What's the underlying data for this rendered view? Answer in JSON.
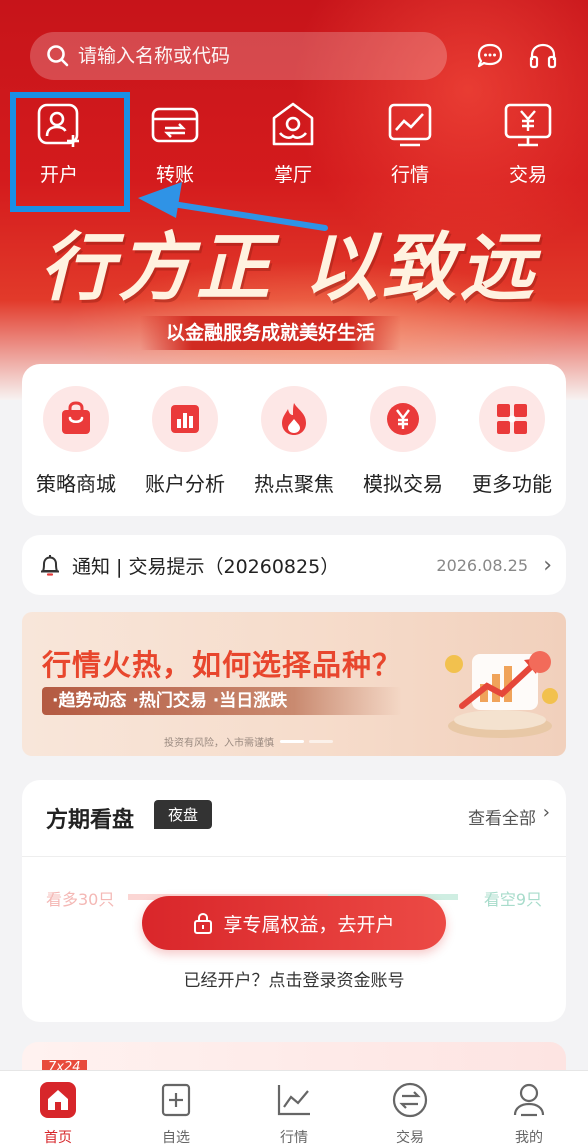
{
  "search": {
    "placeholder": "请输入名称或代码"
  },
  "top_icons": [
    "chat-icon",
    "headset-icon"
  ],
  "quick_nav": [
    {
      "label": "开户",
      "icon": "open-account-icon"
    },
    {
      "label": "转账",
      "icon": "transfer-icon"
    },
    {
      "label": "掌厅",
      "icon": "hall-icon"
    },
    {
      "label": "行情",
      "icon": "market-icon"
    },
    {
      "label": "交易",
      "icon": "trade-icon"
    }
  ],
  "hero": {
    "slogan": "行方正 以致远",
    "subtitle": "以金融服务成就美好生活"
  },
  "features": [
    {
      "label": "策略商城",
      "icon": "shopping-bag-icon"
    },
    {
      "label": "账户分析",
      "icon": "bar-chart-icon"
    },
    {
      "label": "热点聚焦",
      "icon": "flame-icon"
    },
    {
      "label": "模拟交易",
      "icon": "yen-coin-icon"
    },
    {
      "label": "更多功能",
      "icon": "grid-icon"
    }
  ],
  "notice": {
    "title": "通知 | 交易提示（20260825）",
    "date": "2026.08.25"
  },
  "banner": {
    "headline": "行情火热，如何选择品种？",
    "tags": "·趋势动态  ·热门交易  ·当日涨跌",
    "risk": "投资有风险，入市需谨慎"
  },
  "market": {
    "title": "方期看盘",
    "badge": "夜盘",
    "view_all": "查看全部",
    "bull": "看多30只",
    "bear": "看空9只",
    "open_button": "享专属权益，去开户",
    "login_link": "已经开户？点击登录资金账号"
  },
  "peek_tag": "7x24",
  "tabbar": [
    {
      "label": "首页",
      "icon": "home-icon",
      "active": true
    },
    {
      "label": "自选",
      "icon": "add-favorite-icon"
    },
    {
      "label": "行情",
      "icon": "trend-icon"
    },
    {
      "label": "交易",
      "icon": "exchange-icon"
    },
    {
      "label": "我的",
      "icon": "profile-icon"
    }
  ],
  "colors": {
    "brand_red": "#d7262a",
    "highlight_blue": "#1a8fe5"
  }
}
